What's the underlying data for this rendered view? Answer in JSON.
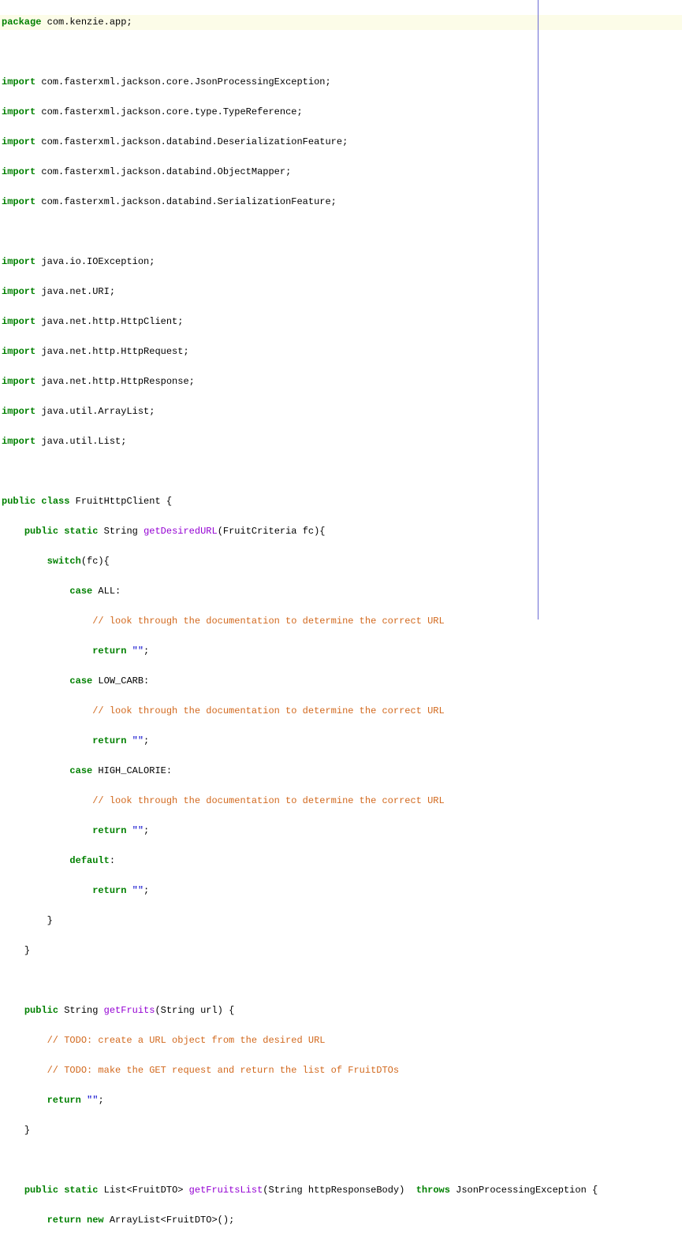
{
  "code": {
    "package_kw": "package",
    "package_name": " com.kenzie.app;",
    "import_kw": "import",
    "imports": [
      " com.fasterxml.jackson.core.JsonProcessingException;",
      " com.fasterxml.jackson.core.type.TypeReference;",
      " com.fasterxml.jackson.databind.DeserializationFeature;",
      " com.fasterxml.jackson.databind.ObjectMapper;",
      " com.fasterxml.jackson.databind.SerializationFeature;"
    ],
    "imports2": [
      " java.io.IOException;",
      " java.net.URI;",
      " java.net.http.HttpClient;",
      " java.net.http.HttpRequest;",
      " java.net.http.HttpResponse;",
      " java.util.ArrayList;",
      " java.util.List;"
    ],
    "public_kw": "public",
    "class_kw": "class",
    "static_kw": "static",
    "switch_kw": "switch",
    "case_kw": "case",
    "return_kw": "return",
    "default_kw": "default",
    "new_kw": "new",
    "throws_kw": "throws",
    "class_name": " FruitHttpClient {",
    "method1_ret": " String ",
    "method1_name": "getDesiredURL",
    "method1_params": "(FruitCriteria fc){",
    "switch_expr": "(fc){",
    "case_all": " ALL:",
    "case_lowcarb": " LOW_CARB:",
    "case_highcal": " HIGH_CALORIE:",
    "comment_doc": "// look through the documentation to determine the correct URL",
    "return_empty": " \"\"",
    "semi": ";",
    "colon": ":",
    "brace_close": "}",
    "method2_ret": " String ",
    "method2_name": "getFruits",
    "method2_params": "(String url) {",
    "comment_todo1": "// TODO: create a URL object from the desired URL",
    "comment_todo2": "// TODO: make the GET request and return the list of FruitDTOs",
    "method3_ret": " List<FruitDTO> ",
    "method3_name": "getFruitsList",
    "method3_params": "(String httpResponseBody)  ",
    "method3_throws": " JsonProcessingException {",
    "method3_return": " ArrayList<FruitDTO>();"
  }
}
